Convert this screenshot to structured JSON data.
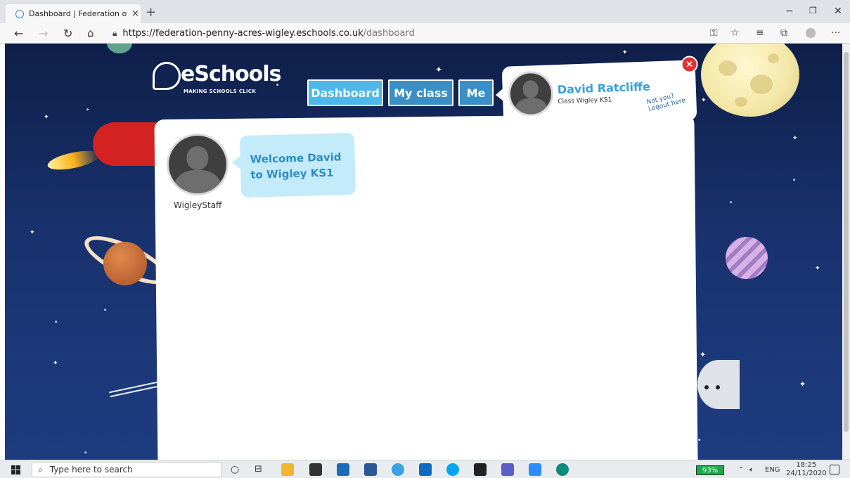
{
  "browser": {
    "tab_title": "Dashboard | Federation of Penny Acres",
    "tab_close": "×",
    "new_tab": "+",
    "url_host": "https://federation-penny-acres-wigley.eschools.co.uk",
    "url_path": "/dashboard",
    "min": "−",
    "restore": "❐",
    "close": "✕"
  },
  "site": {
    "logo_text": "eSchools",
    "logo_tagline": "MAKING SCHOOLS CLICK",
    "nav": [
      {
        "label": "Dashboard",
        "active": true
      },
      {
        "label": "My class",
        "active": false
      },
      {
        "label": "Me",
        "active": false
      }
    ]
  },
  "user": {
    "name": "David Ratcliffe",
    "class": "Class Wigley KS1",
    "logout_line1": "Not you?",
    "logout_line2": "Logout here",
    "close_icon": "×"
  },
  "dashboard": {
    "welcome_line1": "Welcome David",
    "welcome_line2": "to Wigley KS1",
    "staff_name": "WigleyStaff"
  },
  "taskbar": {
    "search_placeholder": "Type here to search",
    "battery": "93%",
    "tray_lang": "ENG",
    "time": "18:25",
    "date": "24/11/2020"
  }
}
